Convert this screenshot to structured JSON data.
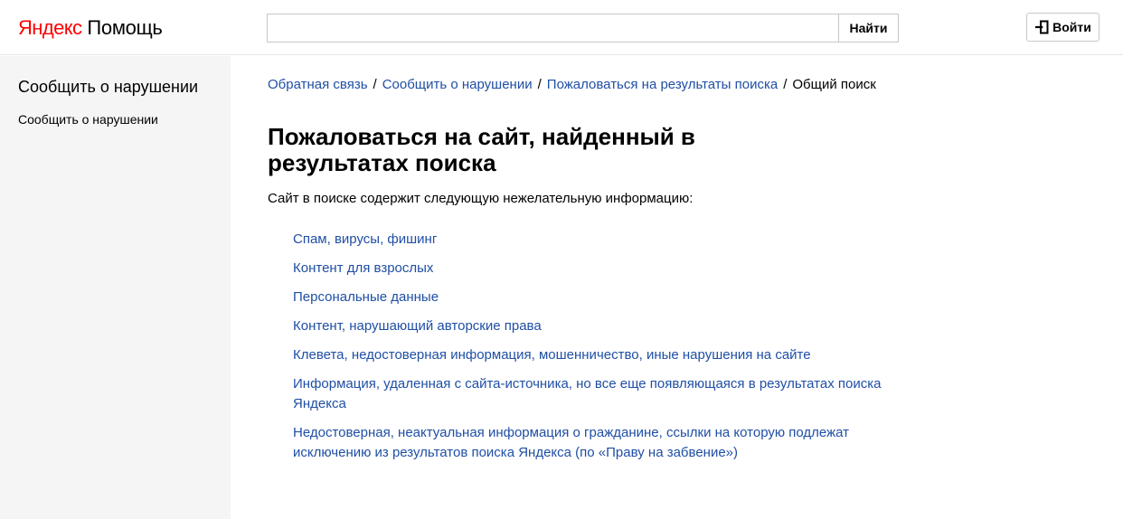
{
  "header": {
    "logo_yandex": "Яндекс",
    "logo_service": "Помощь",
    "search_value": "",
    "search_button": "Найти",
    "login_label": "Войти",
    "login_icon": "login-arrow-icon"
  },
  "sidebar": {
    "title": "Сообщить о нарушении",
    "items": [
      {
        "label": "Сообщить о нарушении"
      }
    ]
  },
  "breadcrumbs": {
    "links": [
      "Обратная связь",
      "Сообщить о нарушении",
      "Пожаловаться на результаты поиска"
    ],
    "separator": "/",
    "current": "Общий поиск"
  },
  "main": {
    "title": "Пожаловаться на сайт, найденный в результатах поиска",
    "intro": "Сайт в поиске содержит следующую нежелательную информацию:",
    "links": [
      "Спам, вирусы, фишинг",
      "Контент для взрослых",
      "Персональные данные",
      "Контент, нарушающий авторские права",
      "Клевета, недостоверная информация, мошенничество, иные нарушения на сайте",
      "Информация, удаленная с сайта-источника, но все еще появляющаяся в результатах поиска Яндекса",
      "Недостоверная, неактуальная информация о гражданине, ссылки на которую подлежат исключению из результатов поиска Яндекса (по «Праву на забвение»)"
    ]
  },
  "colors": {
    "link": "#1f4fa5",
    "logo_red": "#ff0000",
    "sidebar_bg": "#f5f5f5"
  }
}
